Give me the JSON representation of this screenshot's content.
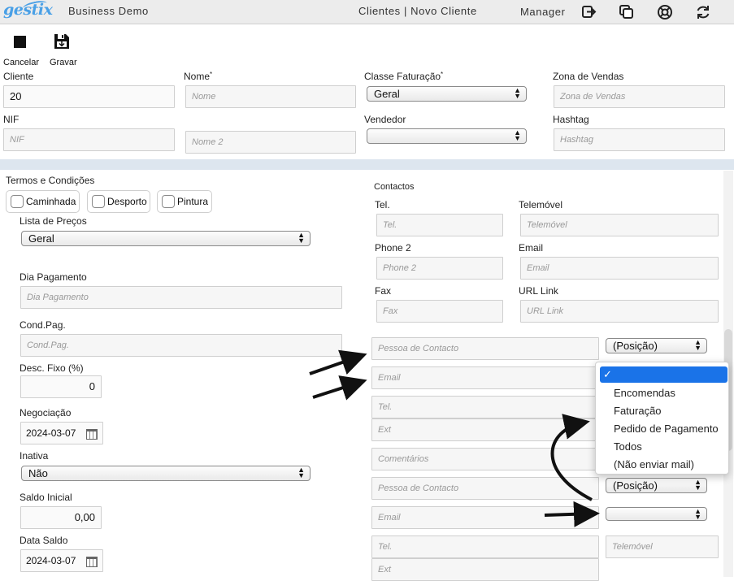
{
  "header": {
    "logo": "gestix",
    "company": "Business Demo",
    "breadcrumb": "Clientes | Novo Cliente",
    "user": "Manager"
  },
  "toolbar": {
    "cancel_label": "Cancelar",
    "save_label": "Gravar"
  },
  "form": {
    "cliente": {
      "label": "Cliente",
      "value": "20"
    },
    "nome": {
      "label": "Nome",
      "required_mark": "*",
      "placeholder": "Nome"
    },
    "classe_faturacao": {
      "label": "Classe Faturação",
      "required_mark": "*",
      "value": "Geral"
    },
    "zona_vendas": {
      "label": "Zona de Vendas",
      "placeholder": "Zona de Vendas"
    },
    "nif": {
      "label": "NIF",
      "placeholder": "NIF"
    },
    "nome2": {
      "placeholder": "Nome 2"
    },
    "vendedor": {
      "label": "Vendedor",
      "value": ""
    },
    "hashtag": {
      "label": "Hashtag",
      "placeholder": "Hashtag"
    }
  },
  "terms": {
    "label": "Termos e Condições",
    "options": [
      {
        "label": "Caminhada",
        "checked": false
      },
      {
        "label": "Desporto",
        "checked": false
      },
      {
        "label": "Pintura",
        "checked": false
      }
    ]
  },
  "left": {
    "lista_precos": {
      "label": "Lista de Preços",
      "value": "Geral"
    },
    "dia_pagamento": {
      "label": "Dia Pagamento",
      "placeholder": "Dia Pagamento"
    },
    "cond_pag": {
      "label": "Cond.Pag.",
      "placeholder": "Cond.Pag."
    },
    "desc_fixo": {
      "label": "Desc. Fixo (%)",
      "value": "0"
    },
    "negociacao": {
      "label": "Negociação",
      "value": "2024-03-07"
    },
    "inativa": {
      "label": "Inativa",
      "value": "Não"
    },
    "saldo_inicial": {
      "label": "Saldo Inicial",
      "value": "0,00"
    },
    "data_saldo": {
      "label": "Data Saldo",
      "value": "2024-03-07"
    }
  },
  "contacts": {
    "section_label": "Contactos",
    "tel": {
      "label": "Tel.",
      "placeholder": "Tel."
    },
    "telemovel": {
      "label": "Telemóvel",
      "placeholder": "Telemóvel"
    },
    "phone2": {
      "label": "Phone 2",
      "placeholder": "Phone 2"
    },
    "email": {
      "label": "Email",
      "placeholder": "Email"
    },
    "fax": {
      "label": "Fax",
      "placeholder": "Fax"
    },
    "url": {
      "label": "URL Link",
      "placeholder": "URL Link"
    },
    "contact1": {
      "pessoa": "Pessoa de Contacto",
      "posicao": "(Posição)",
      "email": "Email",
      "tel": "Tel.",
      "ext": "Ext",
      "comentarios": "Comentários"
    },
    "contact2": {
      "pessoa": "Pessoa de Contacto",
      "posicao": "(Posição)",
      "email": "Email",
      "tel": "Tel.",
      "telemovel": "Telemóvel",
      "ext": "Ext"
    }
  },
  "email_type_dropdown": {
    "selected_mark": "✓",
    "options": [
      "Encomendas",
      "Faturação",
      "Pedido de Pagamento",
      "Todos",
      "(Não enviar mail)"
    ]
  }
}
